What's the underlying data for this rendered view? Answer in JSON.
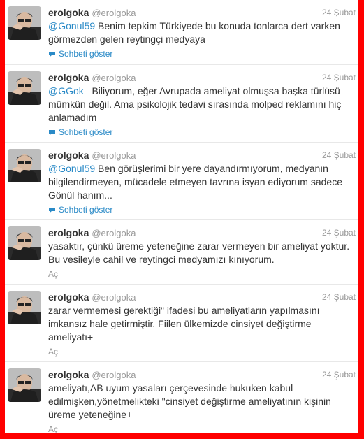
{
  "tweets": [
    {
      "name": "erolgoka",
      "handle": "@erolgoka",
      "time": "24 Şubat",
      "mention": "@Gonul59",
      "text": " Benim tepkim Türkiyede bu konuda tonlarca dert varken görmezden gelen reytingçi medyaya",
      "action": "Sohbeti göster"
    },
    {
      "name": "erolgoka",
      "handle": "@erolgoka",
      "time": "24 Şubat",
      "mention": "@GGok_",
      "text": " Biliyorum, eğer Avrupada ameliyat olmuşsa başka türlüsü mümkün değil. Ama psikolojik tedavi sırasında molped reklamını hiç anlamadım",
      "action": "Sohbeti göster"
    },
    {
      "name": "erolgoka",
      "handle": "@erolgoka",
      "time": "24 Şubat",
      "mention": "@Gonul59",
      "text": " Ben görüşlerimi bir yere dayandırmıyorum, medyanın bilgilendirmeyen, mücadele etmeyen tavrına isyan ediyorum sadece Gönül hanım...",
      "action": "Sohbeti göster"
    },
    {
      "name": "erolgoka",
      "handle": "@erolgoka",
      "time": "24 Şubat",
      "mention": "",
      "text": "yasaktır, çünkü üreme yeteneğine zarar vermeyen bir ameliyat yoktur. Bu vesileyle cahil ve reytingci medyamızı kınıyorum.",
      "action": "Aç"
    },
    {
      "name": "erolgoka",
      "handle": "@erolgoka",
      "time": "24 Şubat",
      "mention": "",
      "text": "zarar vermemesi gerektiği\" ifadesi bu ameliyatların yapılmasını imkansız hale getirmiştir. Fiilen ülkemizde cinsiyet değiştirme ameliyatı+",
      "action": "Aç"
    },
    {
      "name": "erolgoka",
      "handle": "@erolgoka",
      "time": "24 Şubat",
      "mention": "",
      "text": "ameliyatı,AB uyum yasaları çerçevesinde hukuken kabul edilmişken,yönetmelikteki \"cinsiyet değiştirme ameliyatının kişinin üreme yeteneğine+",
      "action": "Aç"
    }
  ],
  "colors": {
    "border": "#ff0000",
    "link": "#2a8ac7",
    "text": "#333333",
    "muted": "#999999"
  },
  "icons": {
    "avatar": "user-avatar",
    "conversation": "speech-bubble-icon"
  }
}
